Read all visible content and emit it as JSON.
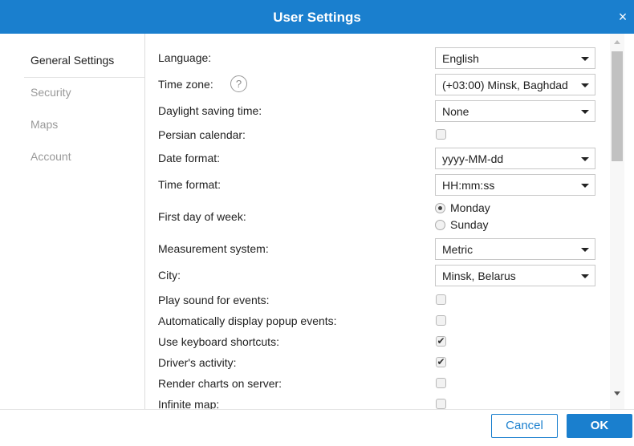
{
  "window": {
    "title": "User Settings",
    "close_glyph": "×"
  },
  "sidebar": {
    "items": [
      {
        "label": "General Settings",
        "active": true
      },
      {
        "label": "Security",
        "active": false
      },
      {
        "label": "Maps",
        "active": false
      },
      {
        "label": "Account",
        "active": false
      }
    ]
  },
  "settings": {
    "language": {
      "label": "Language:",
      "value": "English"
    },
    "timezone": {
      "label": "Time zone:",
      "value": "(+03:00) Minsk, Baghdad",
      "help": "?"
    },
    "dst": {
      "label": "Daylight saving time:",
      "value": "None"
    },
    "persian": {
      "label": "Persian calendar:",
      "checked": false
    },
    "date_format": {
      "label": "Date format:",
      "value": "yyyy-MM-dd"
    },
    "time_format": {
      "label": "Time format:",
      "value": "HH:mm:ss"
    },
    "first_day": {
      "label": "First day of week:",
      "options": [
        "Monday",
        "Sunday"
      ],
      "selected": "Monday"
    },
    "measurement": {
      "label": "Measurement system:",
      "value": "Metric"
    },
    "city": {
      "label": "City:",
      "value": "Minsk, Belarus"
    },
    "play_sound": {
      "label": "Play sound for events:",
      "checked": false
    },
    "auto_popup": {
      "label": "Automatically display popup events:",
      "checked": false
    },
    "keyboard": {
      "label": "Use keyboard shortcuts:",
      "checked": true
    },
    "driver": {
      "label": "Driver's activity:",
      "checked": true
    },
    "render_charts": {
      "label": "Render charts on server:",
      "checked": false
    },
    "infinite_map": {
      "label": "Infinite map:",
      "checked": false
    }
  },
  "footer": {
    "cancel_label": "Cancel",
    "ok_label": "OK"
  },
  "colors": {
    "accent": "#1a7fce"
  }
}
